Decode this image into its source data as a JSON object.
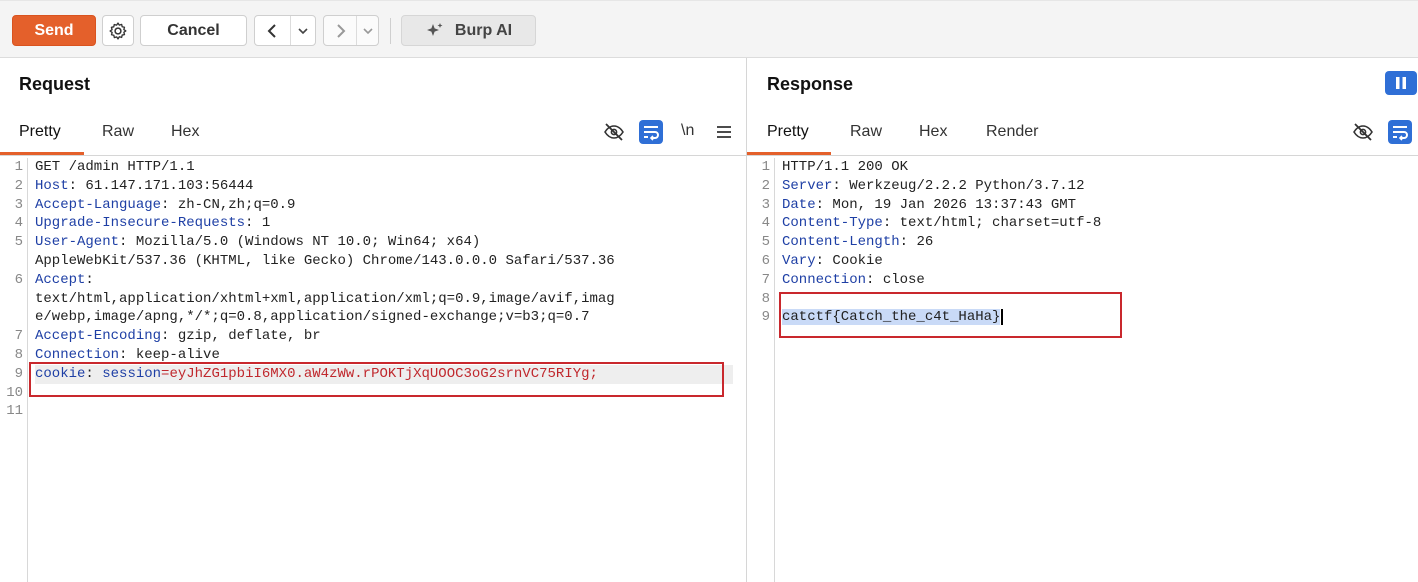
{
  "toolbar": {
    "send": "Send",
    "cancel": "Cancel",
    "burp_ai": "Burp AI"
  },
  "request": {
    "title": "Request",
    "tabs": [
      "Pretty",
      "Raw",
      "Hex"
    ],
    "newline_toggle": "\\n",
    "line_numbers": [
      "1",
      "2",
      "3",
      "4",
      "5",
      "",
      "6",
      "",
      "",
      "7",
      "8",
      "9",
      "10",
      "11"
    ],
    "lines": [
      {
        "text": "GET /admin HTTP/1.1"
      },
      {
        "key": "Host",
        "sep": ": ",
        "value": "61.147.171.103:56444"
      },
      {
        "key": "Accept-Language",
        "sep": ": ",
        "value": "zh-CN,zh;q=0.9"
      },
      {
        "key": "Upgrade-Insecure-Requests",
        "sep": ": ",
        "value": "1"
      },
      {
        "key": "User-Agent",
        "sep": ": ",
        "value": "Mozilla/5.0 (Windows NT 10.0; Win64; x64)"
      },
      {
        "text": "AppleWebKit/537.36 (KHTML, like Gecko) Chrome/143.0.0.0 Safari/537.36"
      },
      {
        "key": "Accept",
        "sep": ":",
        "value": ""
      },
      {
        "text": "text/html,application/xhtml+xml,application/xml;q=0.9,image/avif,imag"
      },
      {
        "text": "e/webp,image/apng,*/*;q=0.8,application/signed-exchange;v=b3;q=0.7"
      },
      {
        "key": "Accept-Encoding",
        "sep": ": ",
        "value": "gzip, deflate, br"
      },
      {
        "key": "Connection",
        "sep": ": ",
        "value": "keep-alive"
      },
      {
        "cookie_key": "cookie",
        "cookie_sep": ": ",
        "cookie_name": "session",
        "cookie_eq": "=",
        "cookie_value": "eyJhZG1pbiI6MX0.aW4zWw.rPOKTjXqUOOC3oG2srnVC75RIYg;"
      },
      {
        "text": ""
      },
      {
        "text": ""
      }
    ]
  },
  "response": {
    "title": "Response",
    "tabs": [
      "Pretty",
      "Raw",
      "Hex",
      "Render"
    ],
    "line_numbers": [
      "1",
      "2",
      "3",
      "4",
      "5",
      "6",
      "7",
      "8",
      "9"
    ],
    "lines": [
      {
        "text": "HTTP/1.1 200 OK"
      },
      {
        "key": "Server",
        "sep": ": ",
        "value": "Werkzeug/2.2.2 Python/3.7.12"
      },
      {
        "key": "Date",
        "sep": ": ",
        "value": "Mon, 19 Jan 2026 13:37:43 GMT"
      },
      {
        "key": "Content-Type",
        "sep": ": ",
        "value": "text/html; charset=utf-8"
      },
      {
        "key": "Content-Length",
        "sep": ": ",
        "value": "26"
      },
      {
        "key": "Vary",
        "sep": ": ",
        "value": "Cookie"
      },
      {
        "key": "Connection",
        "sep": ": ",
        "value": "close"
      },
      {
        "text": ""
      },
      {
        "text": "catctf{Catch_the_c4t_HaHa}",
        "selected": true
      }
    ]
  },
  "colors": {
    "accent": "#e4602b",
    "header_key": "#1e3fa5",
    "cookie_value": "#c0282d",
    "highlight_box": "#c9282d",
    "icon_blue": "#2f6fd6"
  }
}
